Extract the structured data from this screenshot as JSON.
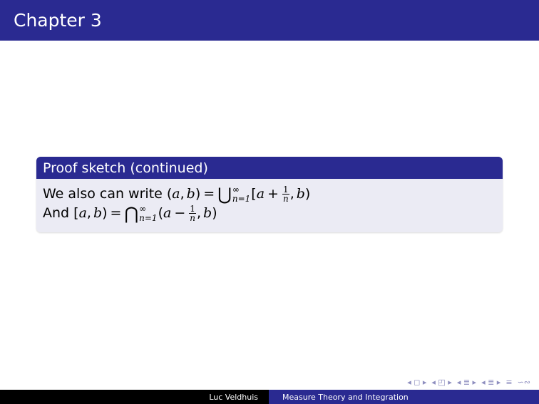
{
  "frame": {
    "title": "Chapter 3"
  },
  "block": {
    "title": "Proof sketch (continued)",
    "line1": {
      "prefix": "We also can write ",
      "lhs_open": "(",
      "a": "a",
      "comma": ",",
      "b": "b",
      "lhs_close": ")",
      "eq": "=",
      "bigop": "⋃",
      "sup": "∞",
      "sub": "n=1",
      "set_open": "[",
      "a2": "a",
      "plus": "+",
      "frac_num": "1",
      "frac_den": "n",
      "comma2": ",",
      "b2": "b",
      "set_close": ")"
    },
    "line2": {
      "prefix": "And ",
      "lhs_open": "[",
      "a": "a",
      "comma": ",",
      "b": "b",
      "lhs_close": ")",
      "eq": "=",
      "bigop": "⋂",
      "sup": "∞",
      "sub": "n=1",
      "set_open": "(",
      "a2": "a",
      "minus": "−",
      "frac_num": "1",
      "frac_den": "n",
      "comma2": ",",
      "b2": "b",
      "set_close": ")"
    }
  },
  "navigation": {
    "prev_frame": "◂ ◻ ▸",
    "prev_subsection": "◂ ◰ ▸",
    "prev_section": "◂ ≣ ▸",
    "next_section": "◂ ≣ ▸",
    "align": "≡",
    "search": "∽∾"
  },
  "footer": {
    "author": "Luc Veldhuis",
    "title": "Measure Theory and Integration"
  }
}
